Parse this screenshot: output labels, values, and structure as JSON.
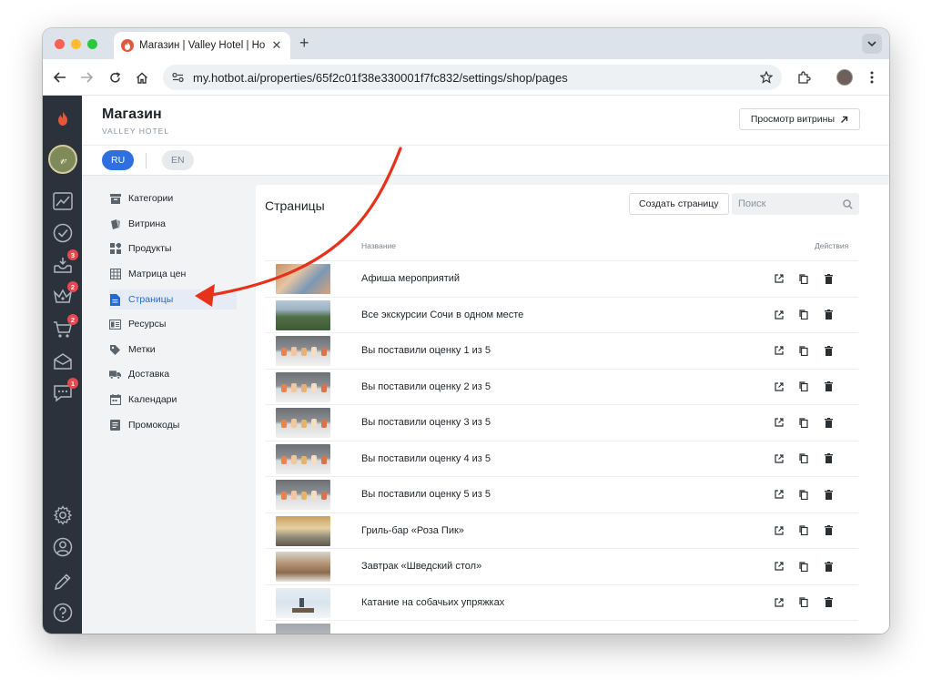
{
  "browser": {
    "tab_title": "Магазин | Valley Hotel | Hotbot",
    "url": "my.hotbot.ai/properties/65f2c01f38e330001f7fc832/settings/shop/pages"
  },
  "rail": {
    "badges": {
      "inbox": "3",
      "crown": "2",
      "cart": "2",
      "chat": "1"
    }
  },
  "header": {
    "title": "Магазин",
    "subtitle": "VALLEY HOTEL",
    "preview_label": "Просмотр витрины"
  },
  "languages": {
    "active": "RU",
    "other": "EN"
  },
  "nav": {
    "items": [
      {
        "label": "Категории",
        "icon": "category-icon"
      },
      {
        "label": "Витрина",
        "icon": "showcase-icon"
      },
      {
        "label": "Продукты",
        "icon": "products-icon"
      },
      {
        "label": "Матрица цен",
        "icon": "price-matrix-icon"
      },
      {
        "label": "Страницы",
        "icon": "page-icon",
        "active": true
      },
      {
        "label": "Ресурсы",
        "icon": "resources-icon"
      },
      {
        "label": "Метки",
        "icon": "tag-icon"
      },
      {
        "label": "Доставка",
        "icon": "truck-icon"
      },
      {
        "label": "Календари",
        "icon": "calendar-icon"
      },
      {
        "label": "Промокоды",
        "icon": "promo-icon"
      }
    ]
  },
  "pages": {
    "title": "Страницы",
    "create_label": "Создать страницу",
    "search_placeholder": "Поиск",
    "col_name": "Название",
    "col_actions": "Действия",
    "rows": [
      {
        "name": "Афиша мероприятий",
        "thumb": "event"
      },
      {
        "name": "Все экскурсии Сочи в одном месте",
        "thumb": "mountains"
      },
      {
        "name": "Вы поставили оценку 1 из 5",
        "thumb": "drinks"
      },
      {
        "name": "Вы поставили оценку 2 из 5",
        "thumb": "drinks"
      },
      {
        "name": "Вы поставили оценку 3 из 5",
        "thumb": "drinks"
      },
      {
        "name": "Вы поставили оценку 4 из 5",
        "thumb": "drinks"
      },
      {
        "name": "Вы поставили оценку 5 из 5",
        "thumb": "drinks"
      },
      {
        "name": "Гриль-бар «Роза Пик»",
        "thumb": "restaurant"
      },
      {
        "name": "Завтрак «Шведский стол»",
        "thumb": "buffet"
      },
      {
        "name": "Катание на собачьих упряжках",
        "thumb": "snow"
      },
      {
        "name": "",
        "thumb": "partial"
      }
    ]
  },
  "colors": {
    "accent": "#1e6bd6",
    "rail": "#2b323b",
    "annotation_arrow": "#e8311a",
    "badge": "#e5484d"
  }
}
